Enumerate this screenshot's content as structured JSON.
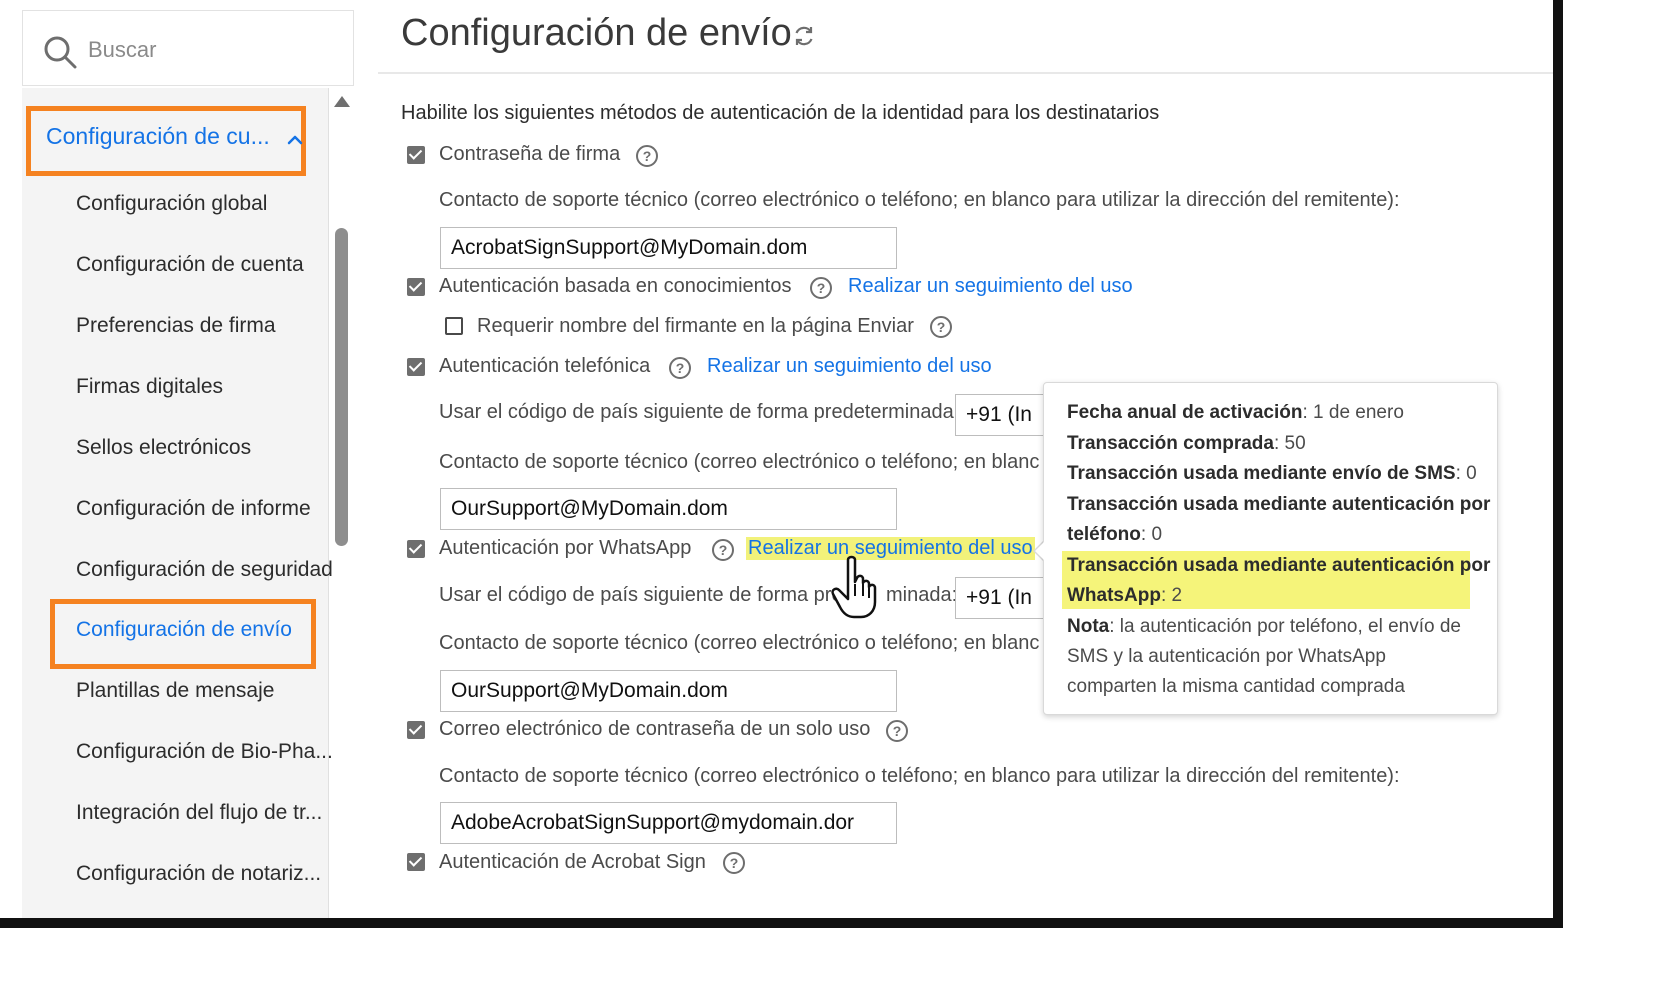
{
  "search": {
    "label": "Buscar"
  },
  "sidebar": {
    "section_label": "Configuración de cu...",
    "items": [
      {
        "label": "Configuración global"
      },
      {
        "label": "Configuración de cuenta"
      },
      {
        "label": "Preferencias de firma"
      },
      {
        "label": "Firmas digitales"
      },
      {
        "label": "Sellos electrónicos"
      },
      {
        "label": "Configuración de informe"
      },
      {
        "label": "Configuración de seguridad"
      },
      {
        "label": "Configuración de envío",
        "active": true
      },
      {
        "label": "Plantillas de mensaje"
      },
      {
        "label": "Configuración de Bio-Pha..."
      },
      {
        "label": "Integración del flujo de tr..."
      },
      {
        "label": "Configuración de notariz..."
      }
    ]
  },
  "main": {
    "title": "Configuración de envío",
    "intro": "Habilite los siguientes métodos de autenticación de la identidad para los destinatarios",
    "password": {
      "label": "Contraseña de firma",
      "checked": true,
      "support_label": "Contacto de soporte técnico (correo electrónico o teléfono; en blanco para utilizar la dirección del remitente):",
      "support_value": "AcrobatSignSupport@MyDomain.dom"
    },
    "kba": {
      "label": "Autenticación basada en conocimientos",
      "checked": true,
      "link": "Realizar un seguimiento del uso",
      "sub_label": "Requerir nombre del firmante en la página Enviar",
      "sub_checked": false
    },
    "phone": {
      "label": "Autenticación telefónica",
      "checked": true,
      "link": "Realizar un seguimiento del uso",
      "country_label": "Usar el código de país siguiente de forma predeterminada:",
      "country_value": "+91 (In",
      "support_label": "Contacto de soporte técnico (correo electrónico o teléfono; en blanc",
      "support_value": "OurSupport@MyDomain.dom"
    },
    "whatsapp": {
      "label": "Autenticación por WhatsApp",
      "checked": true,
      "link": "Realizar un seguimiento del uso",
      "country_label": "Usar el código de país siguiente de forma pre",
      "country_label_tail": "minada:",
      "country_value": "+91 (In",
      "support_label": "Contacto de soporte técnico (correo electrónico o teléfono; en blanc",
      "support_value": "OurSupport@MyDomain.dom"
    },
    "otp": {
      "label": "Correo electrónico de contraseña de un solo uso",
      "checked": true,
      "support_label": "Contacto de soporte técnico (correo electrónico o teléfono; en blanco para utilizar la dirección del remitente):",
      "support_value": "AdobeAcrobatSignSupport@mydomain.dor"
    },
    "acrobat": {
      "label": "Autenticación de Acrobat Sign",
      "checked": true
    }
  },
  "tooltip": {
    "activation_label": "Fecha anual de activación",
    "activation_value": ": 1 de enero",
    "purchased_label": "Transacción comprada",
    "purchased_value": ": 50",
    "sms_label": "Transacción usada mediante envío de SMS",
    "sms_value": ": 0",
    "phone_label_1": "Transacción usada mediante autenticación por",
    "phone_label_2": "teléfono",
    "phone_value": ": 0",
    "whatsapp_label_1": "Transacción usada mediante autenticación por",
    "whatsapp_label_2": "WhatsApp",
    "whatsapp_value": ": 2",
    "note_label": "Nota",
    "note_line_1": ": la autenticación por teléfono, el envío de",
    "note_line_2": "SMS y la autenticación por WhatsApp",
    "note_line_3": "comparten la misma cantidad comprada"
  },
  "colors": {
    "accent_blue": "#1473e6",
    "highlight_orange": "#f58220",
    "highlight_yellow": "#f5f47a"
  }
}
